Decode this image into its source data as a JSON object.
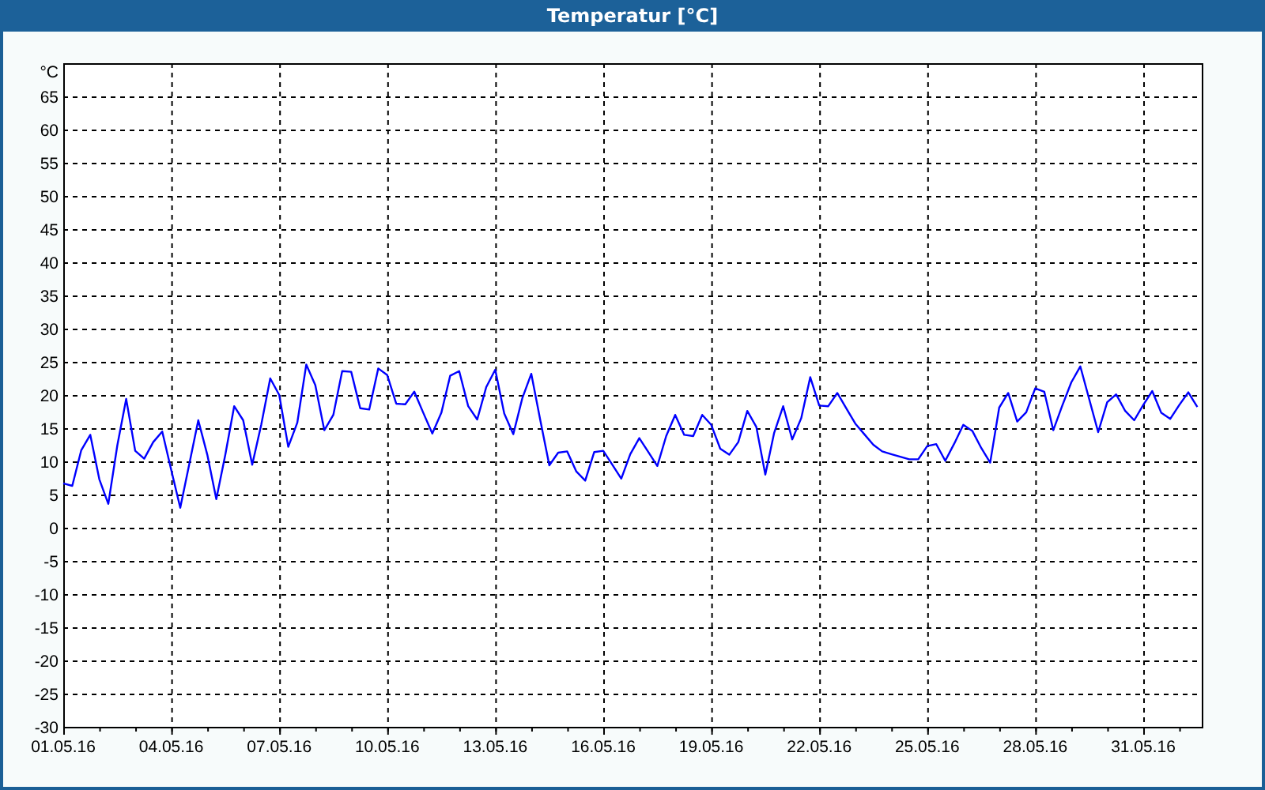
{
  "window": {
    "title": "Temperatur [°C]"
  },
  "chart": {
    "chart_data": {
      "type": "line",
      "grid": true,
      "ylabel": "°C",
      "ylim": [
        -30,
        70
      ],
      "yticks": [
        -30,
        -25,
        -20,
        -15,
        -10,
        -5,
        0,
        5,
        10,
        15,
        20,
        25,
        30,
        35,
        40,
        45,
        50,
        55,
        60,
        65
      ],
      "categories": [
        "01.05.16",
        null,
        null,
        null,
        null,
        null,
        null,
        null,
        null,
        null,
        null,
        null,
        "04.05.16",
        null,
        null,
        null,
        null,
        null,
        null,
        null,
        null,
        null,
        null,
        null,
        "07.05.16",
        null,
        null,
        null,
        null,
        null,
        null,
        null,
        null,
        null,
        null,
        null,
        "10.05.16",
        null,
        null,
        null,
        null,
        null,
        null,
        null,
        null,
        null,
        null,
        null,
        "13.05.16",
        null,
        null,
        null,
        null,
        null,
        null,
        null,
        null,
        null,
        null,
        null,
        "16.05.16",
        null,
        null,
        null,
        null,
        null,
        null,
        null,
        null,
        null,
        null,
        null,
        "19.05.16",
        null,
        null,
        null,
        null,
        null,
        null,
        null,
        null,
        null,
        null,
        null,
        "22.05.16",
        null,
        null,
        null,
        null,
        null,
        null,
        null,
        null,
        null,
        null,
        null,
        "25.05.16",
        null,
        null,
        null,
        null,
        null,
        null,
        null,
        null,
        null,
        null,
        null,
        "28.05.16",
        null,
        null,
        null,
        null,
        null,
        null,
        null,
        null,
        null,
        null,
        null,
        "31.05.16",
        null,
        null,
        null,
        null,
        null,
        null
      ],
      "series": [
        {
          "color": "#0000ff",
          "values": [
            6.7,
            6.3,
            11.7,
            14,
            7.3,
            3.6,
            12.4,
            19.4,
            11.6,
            10.4,
            12.9,
            14.5,
            8.7,
            3,
            9.6,
            16.2,
            11,
            4.3,
            11,
            18.3,
            16.2,
            9.5,
            15.5,
            22.5,
            20,
            12.2,
            15.8,
            24.6,
            21.5,
            14.7,
            17,
            23.6,
            23.5,
            18,
            17.8,
            24,
            23,
            18.7,
            18.6,
            20.5,
            17.3,
            14.2,
            17.3,
            22.9,
            23.6,
            18.3,
            16.3,
            21.2,
            23.8,
            17.2,
            14.1,
            19.5,
            23.2,
            16.2,
            9.4,
            11.3,
            11.5,
            8.5,
            7.1,
            11.4,
            11.6,
            9.5,
            7.4,
            11.1,
            13.5,
            11.4,
            9.3,
            13.8,
            17,
            14,
            13.8,
            17,
            15.5,
            11.9,
            11,
            12.9,
            17.6,
            15.2,
            8,
            14.3,
            18.3,
            13.3,
            16.5,
            22.7,
            18.4,
            18.3,
            20.3,
            18,
            15.7,
            14.1,
            12.5,
            11.5,
            11.1,
            10.7,
            10.3,
            10.3,
            12.3,
            12.6,
            10.1,
            12.7,
            15.5,
            14.6,
            12,
            9.8,
            18.1,
            20.3,
            16,
            17.4,
            21,
            20.5,
            14.7,
            18.4,
            21.9,
            24.3,
            19.3,
            14.4,
            18.9,
            20.1,
            17.6,
            16.2,
            18.5,
            20.6,
            17.3,
            16.4,
            18.5,
            20.4,
            18.2
          ]
        }
      ]
    }
  }
}
